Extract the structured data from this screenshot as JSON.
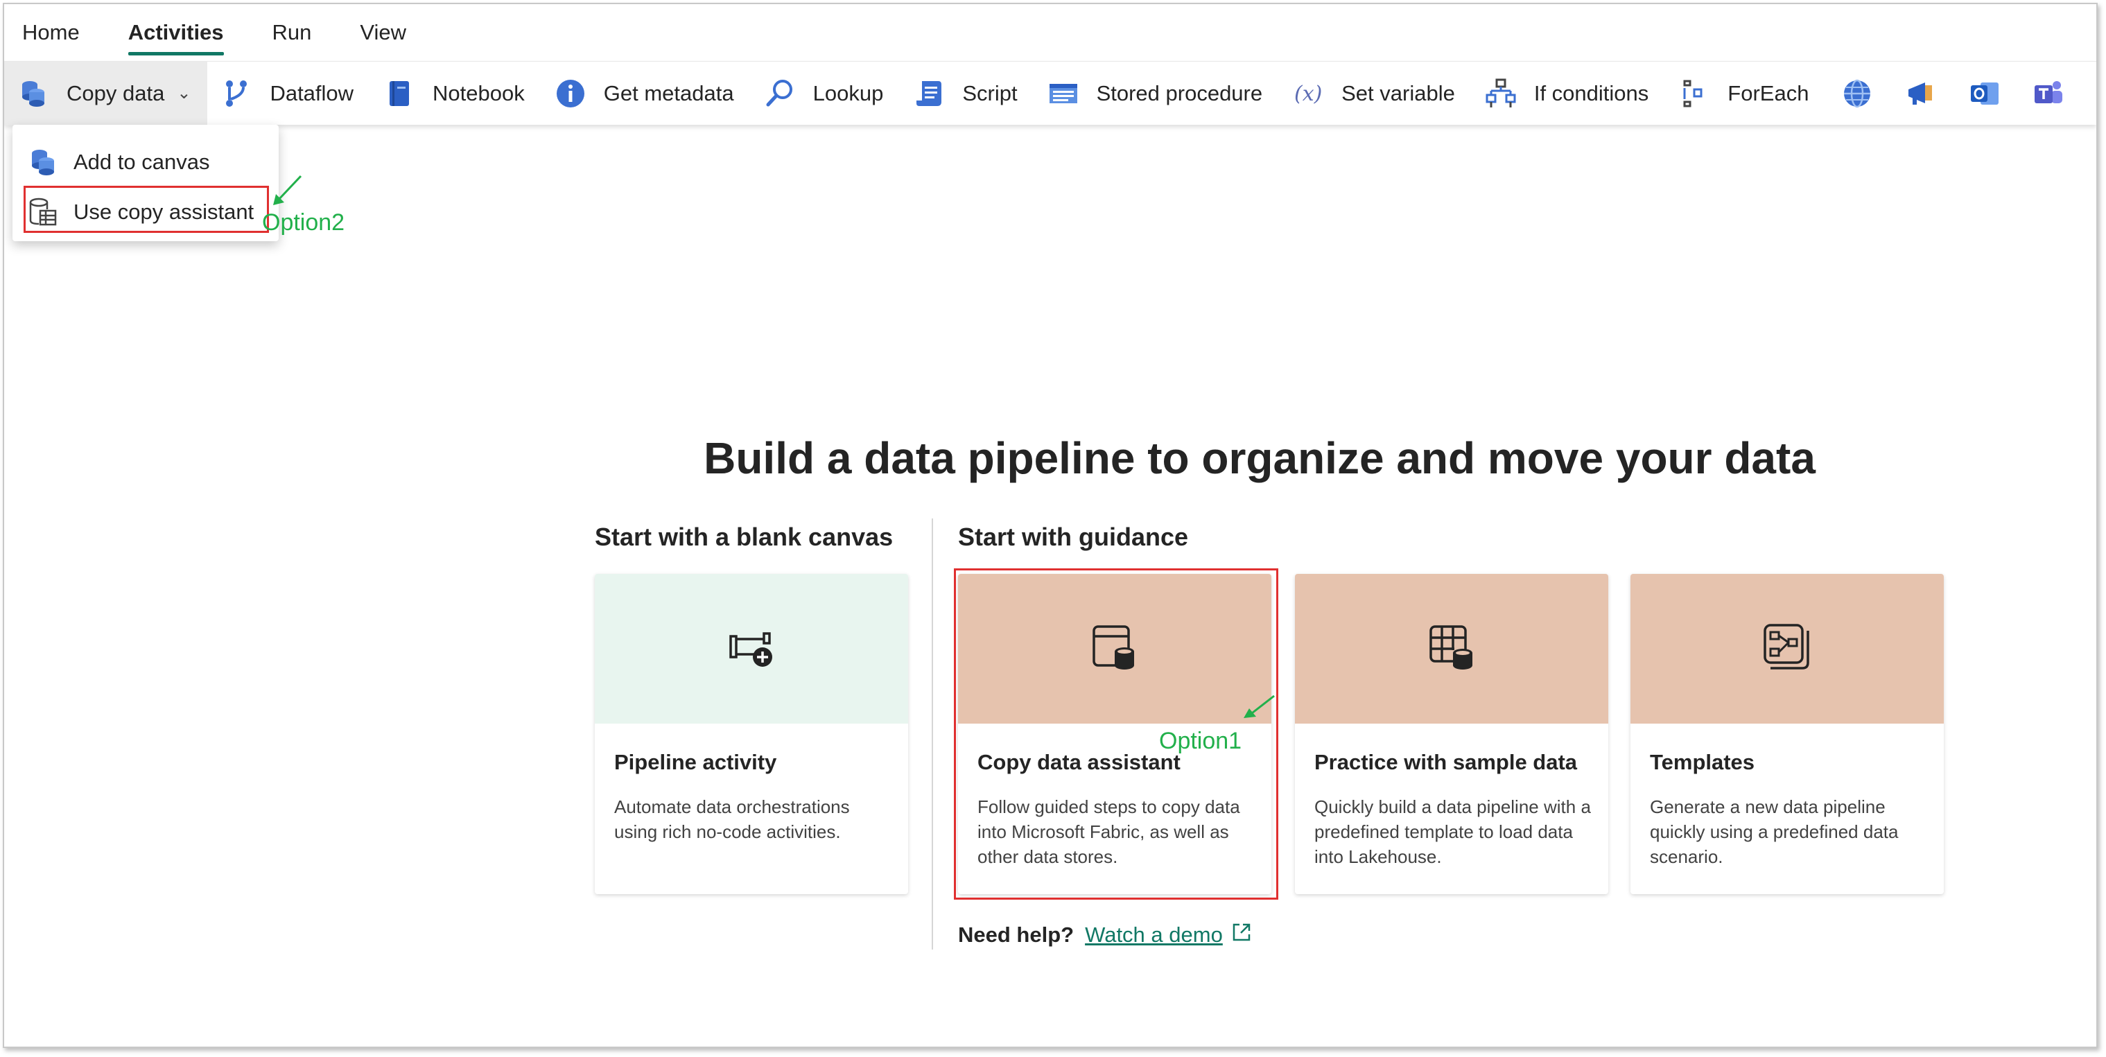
{
  "topnav": {
    "tabs": [
      {
        "label": "Home"
      },
      {
        "label": "Activities"
      },
      {
        "label": "Run"
      },
      {
        "label": "View"
      }
    ]
  },
  "ribbon": {
    "items": [
      {
        "label": "Copy data",
        "icon": "copy-data-icon"
      },
      {
        "label": "Dataflow",
        "icon": "dataflow-icon"
      },
      {
        "label": "Notebook",
        "icon": "notebook-icon"
      },
      {
        "label": "Get metadata",
        "icon": "info-icon"
      },
      {
        "label": "Lookup",
        "icon": "lookup-icon"
      },
      {
        "label": "Script",
        "icon": "script-icon"
      },
      {
        "label": "Stored procedure",
        "icon": "stored-procedure-icon"
      },
      {
        "label": "Set variable",
        "icon": "variable-icon"
      },
      {
        "label": "If conditions",
        "icon": "if-conditions-icon"
      },
      {
        "label": "ForEach",
        "icon": "foreach-icon"
      }
    ],
    "icon_only": [
      "web-icon",
      "teams-megaphone-icon",
      "outlook-icon",
      "teams-icon"
    ]
  },
  "dropdown": {
    "items": [
      {
        "label": "Add to canvas"
      },
      {
        "label": "Use copy assistant"
      }
    ]
  },
  "annotations": {
    "option1": "Option1",
    "option2": "Option2",
    "color": "#22b04b",
    "box_color": "#e03030"
  },
  "main": {
    "title": "Build a data pipeline to organize and move your data",
    "blank_section_title": "Start with a blank canvas",
    "guidance_section_title": "Start with guidance",
    "cards": [
      {
        "title": "Pipeline activity",
        "desc": "Automate data orchestrations using rich no-code activities.",
        "bg": "#e8f5ef"
      },
      {
        "title": "Copy data assistant",
        "desc": "Follow guided steps to copy data into Microsoft Fabric, as well as other data stores.",
        "bg": "#e6c3ae"
      },
      {
        "title": "Practice with sample data",
        "desc": "Quickly build a data pipeline with a predefined template to load data into Lakehouse.",
        "bg": "#e6c3ae"
      },
      {
        "title": "Templates",
        "desc": "Generate a new data pipeline quickly using a predefined data scenario.",
        "bg": "#e6c3ae"
      }
    ],
    "help_label": "Need help?",
    "help_link": "Watch a demo"
  },
  "colors": {
    "accent": "#117865"
  }
}
